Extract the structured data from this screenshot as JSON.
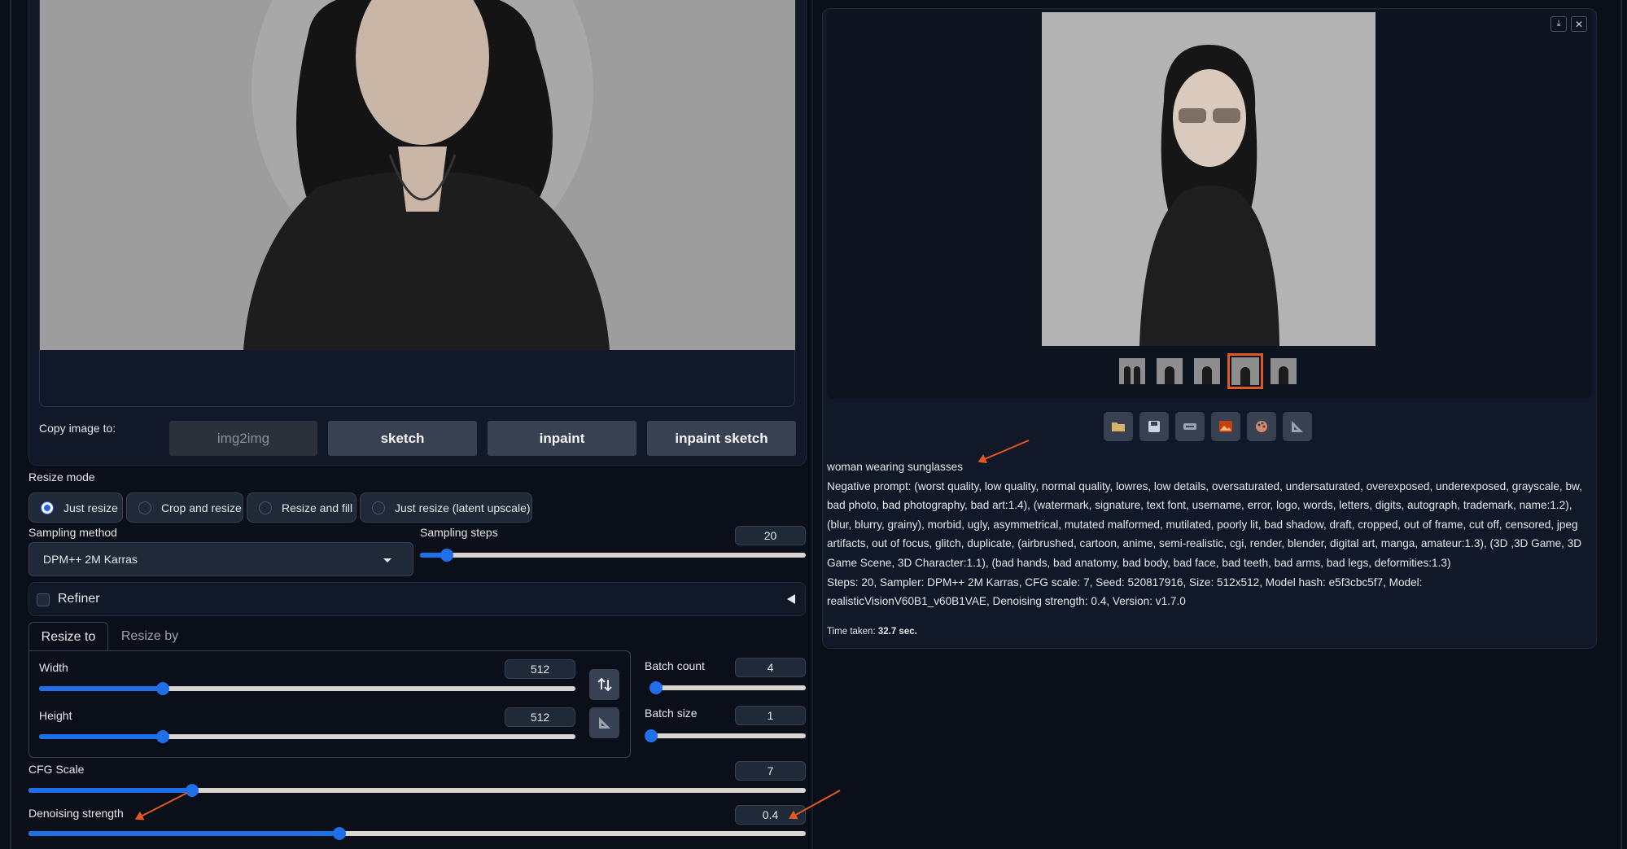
{
  "left": {
    "copy_image_to": {
      "label": "Copy image to:",
      "buttons": [
        "img2img",
        "sketch",
        "inpaint",
        "inpaint sketch"
      ]
    },
    "resize_mode": {
      "label": "Resize mode",
      "options": [
        "Just resize",
        "Crop and resize",
        "Resize and fill",
        "Just resize (latent upscale)"
      ],
      "selected": "Just resize"
    },
    "sampling_method": {
      "label": "Sampling method",
      "value": "DPM++ 2M Karras"
    },
    "sampling_steps": {
      "label": "Sampling steps",
      "value": "20",
      "fraction": 0.07
    },
    "refiner": {
      "label": "Refiner",
      "checked": false
    },
    "tabs": [
      "Resize to",
      "Resize by"
    ],
    "width": {
      "label": "Width",
      "value": "512",
      "fraction": 0.23
    },
    "height": {
      "label": "Height",
      "value": "512",
      "fraction": 0.23
    },
    "batch_count": {
      "label": "Batch count",
      "value": "4",
      "fraction": 0.03
    },
    "batch_size": {
      "label": "Batch size",
      "value": "1",
      "fraction": 0.0
    },
    "cfg_scale": {
      "label": "CFG Scale",
      "value": "7",
      "fraction": 0.21
    },
    "denoising_strength": {
      "label": "Denoising strength",
      "value": "0.4",
      "fraction": 0.4
    }
  },
  "right": {
    "prompt": "woman wearing sunglasses",
    "negative_prompt": "Negative prompt: (worst quality, low quality, normal quality, lowres, low details, oversaturated, undersaturated, overexposed, underexposed, grayscale, bw, bad photo, bad photography, bad art:1.4), (watermark, signature, text font, username, error, logo, words, letters, digits, autograph, trademark, name:1.2), (blur, blurry, grainy), morbid, ugly, asymmetrical, mutated malformed, mutilated, poorly lit, bad shadow, draft, cropped, out of frame, cut off, censored, jpeg artifacts, out of focus, glitch, duplicate, (airbrushed, cartoon, anime, semi-realistic, cgi, render, blender, digital art, manga, amateur:1.3), (3D ,3D Game, 3D Game Scene, 3D Character:1.1), (bad hands, bad anatomy, bad body, bad face, bad teeth, bad arms, bad legs, deformities:1.3)",
    "generation_params": "Steps: 20, Sampler: DPM++ 2M Karras, CFG scale: 7, Seed: 520817916, Size: 512x512, Model hash: e5f3cbc5f7, Model: realisticVisionV60B1_v60B1VAE, Denoising strength: 0.4, Version: v1.7.0",
    "time_taken_label": "Time taken:",
    "time_taken_value": "32.7 sec.",
    "thumbnail_count": 5,
    "selected_thumbnail": 4,
    "tools": [
      "folder-icon",
      "save-icon",
      "zip-icon",
      "image-icon",
      "palette-icon",
      "ruler-icon"
    ]
  },
  "colors": {
    "background": "#0b0f19",
    "panel": "#111827",
    "accent": "#1f6feb",
    "annotation": "#e25822",
    "selected_thumbnail_border": "#e25822"
  }
}
